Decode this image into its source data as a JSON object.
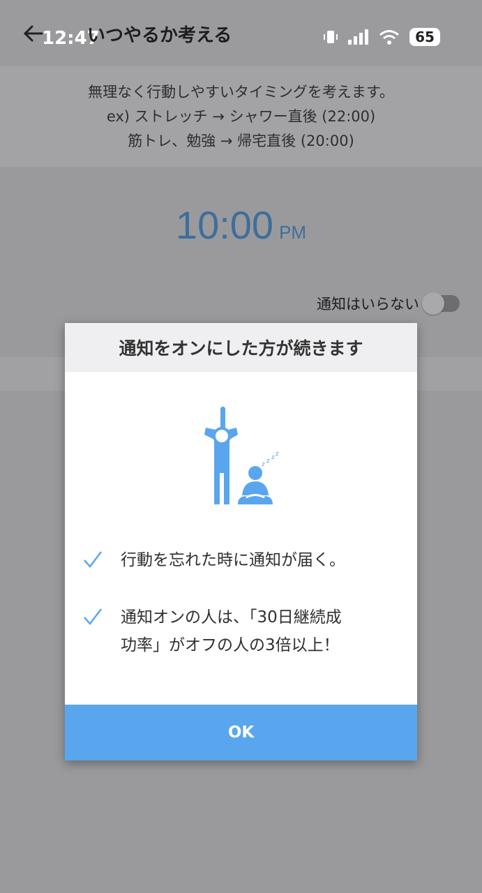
{
  "status_bar": {
    "time": "12:47",
    "battery": "65"
  },
  "app_bar": {
    "title": "いつやるか考える"
  },
  "info": {
    "line1": "無理なく行動しやすいタイミングを考えます。",
    "line2": "ex) ストレッチ → シャワー直後 (22:00)",
    "line3": "筋トレ、勉強 → 帰宅直後 (20:00)"
  },
  "time_picker": {
    "time": "10:00",
    "ampm": "PM"
  },
  "notification_toggle": {
    "label": "通知はいらない",
    "on": false
  },
  "dialog": {
    "title": "通知をオンにした方が続きます",
    "benefits": [
      {
        "text": "行動を忘れた時に通知が届く。"
      },
      {
        "text_line1": "通知オンの人は、「30日継続成",
        "text_line2": "功率」がオフの人の3倍以上！"
      }
    ],
    "ok_label": "OK",
    "accent": "#5aa6ee"
  }
}
